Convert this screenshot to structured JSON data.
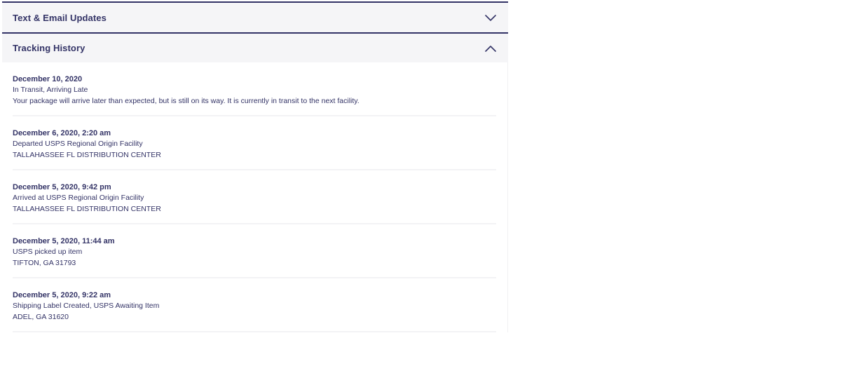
{
  "sections": {
    "text_email": {
      "title": "Text & Email Updates",
      "expanded": false
    },
    "tracking": {
      "title": "Tracking History",
      "expanded": true
    }
  },
  "events": [
    {
      "date": "December 10, 2020",
      "status": "In Transit, Arriving Late",
      "detail": "Your package will arrive later than expected, but is still on its way. It is currently in transit to the next facility."
    },
    {
      "date": "December 6, 2020, 2:20 am",
      "status": "Departed USPS Regional Origin Facility",
      "detail": "TALLAHASSEE FL DISTRIBUTION CENTER"
    },
    {
      "date": "December 5, 2020, 9:42 pm",
      "status": "Arrived at USPS Regional Origin Facility",
      "detail": "TALLAHASSEE FL DISTRIBUTION CENTER"
    },
    {
      "date": "December 5, 2020, 11:44 am",
      "status": "USPS picked up item",
      "detail": "TIFTON, GA 31793"
    },
    {
      "date": "December 5, 2020, 9:22 am",
      "status": "Shipping Label Created, USPS Awaiting Item",
      "detail": "ADEL, GA 31620"
    }
  ],
  "colors": {
    "navy": "#333366",
    "header_bg": "#f5f5f7",
    "divider": "#f3f3f5"
  },
  "icons": {
    "collapsed": "chevron-down-icon",
    "expanded": "chevron-up-icon"
  }
}
